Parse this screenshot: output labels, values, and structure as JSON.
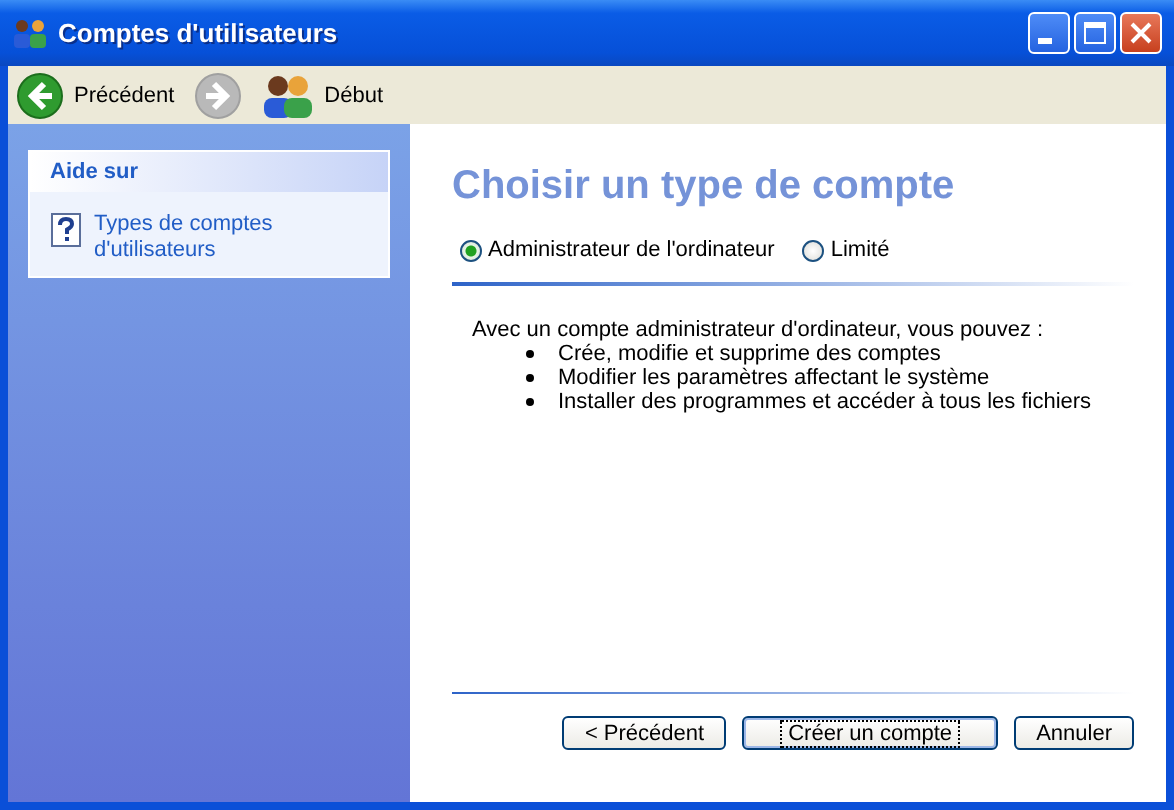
{
  "window": {
    "title": "Comptes d'utilisateurs"
  },
  "toolbar": {
    "items": [
      {
        "kind": "back",
        "label": "Précédent",
        "disabled": false
      },
      {
        "kind": "forward",
        "disabled": true
      },
      {
        "kind": "home",
        "label": "Début",
        "disabled": false
      }
    ]
  },
  "sidebar": {
    "panel_title": "Aide sur",
    "links": [
      {
        "label": "Types de comptes d'utilisateurs"
      }
    ]
  },
  "content": {
    "heading": "Choisir un type de compte",
    "options": [
      {
        "label": "Administrateur de l'ordinateur",
        "selected": true
      },
      {
        "label": "Limité",
        "selected": false
      }
    ],
    "intro": "Avec un compte administrateur d'ordinateur, vous pouvez :",
    "bullets": [
      "Crée, modifie et supprime des comptes",
      "Modifier les paramètres affectant le système",
      "Installer des programmes et accéder à tous les fichiers"
    ]
  },
  "buttons": [
    {
      "label": "< Précédent",
      "default": false
    },
    {
      "label": "Créer un compte",
      "default": true
    },
    {
      "label": "Annuler",
      "default": false
    }
  ]
}
